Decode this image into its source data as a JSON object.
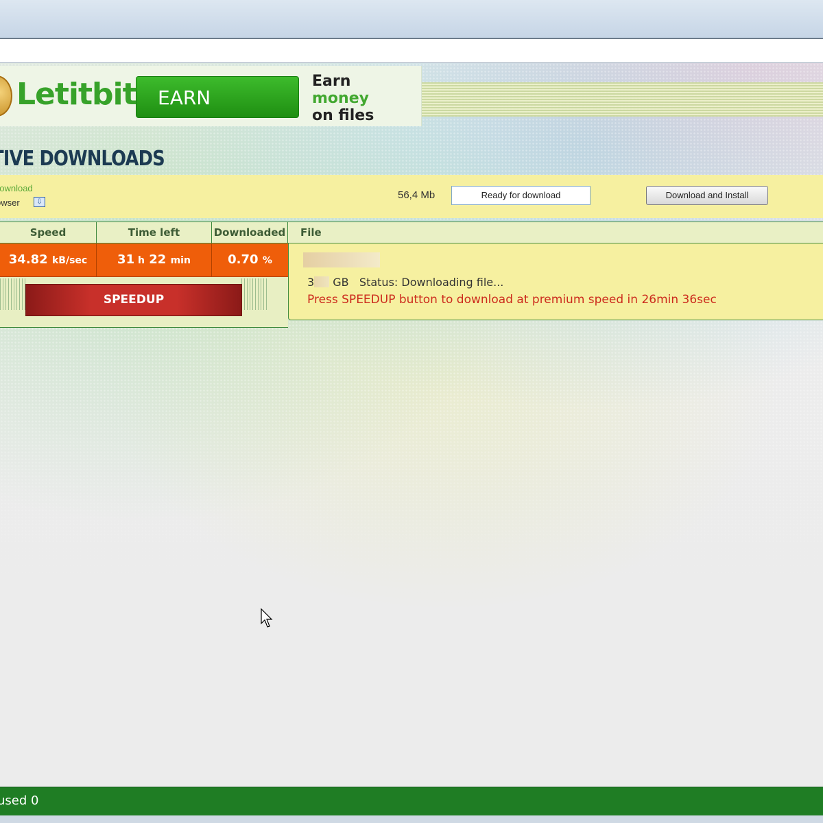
{
  "banner": {
    "logo_text": "Letitbit",
    "earn_button": "EARN",
    "slogan_line1": "Earn",
    "slogan_line2": "money",
    "slogan_line3": "on files"
  },
  "section_title": "TIVE DOWNLOADS",
  "promo_bar": {
    "link_text": "download",
    "browser_text": "owser",
    "size": "56,4 Mb",
    "status": "Ready for download",
    "install_button": "Download and Install"
  },
  "table": {
    "headers": [
      "Speed",
      "Time left",
      "Downloaded",
      "File"
    ],
    "speed_value": "34.82",
    "speed_unit": "kB/sec",
    "time_hours": "31",
    "time_h_unit": "h",
    "time_minutes": "22",
    "time_min_unit": "min",
    "downloaded_value": "0.70",
    "downloaded_unit": "%",
    "speedup_button": "SPEEDUP",
    "file_size_prefix": "3",
    "file_size_unit": "GB",
    "status_label": "Status:",
    "status_value": "Downloading file...",
    "premium_message": "Press SPEEDUP button to download at premium speed in 26min 36sec"
  },
  "status_bar": {
    "text": "used 0"
  },
  "colors": {
    "accent_orange": "#ef5e0a",
    "speedup_red": "#c8302a",
    "brand_green": "#37a22a",
    "status_bar_green": "#1f7d24",
    "promo_yellow": "#f6f0a0"
  }
}
